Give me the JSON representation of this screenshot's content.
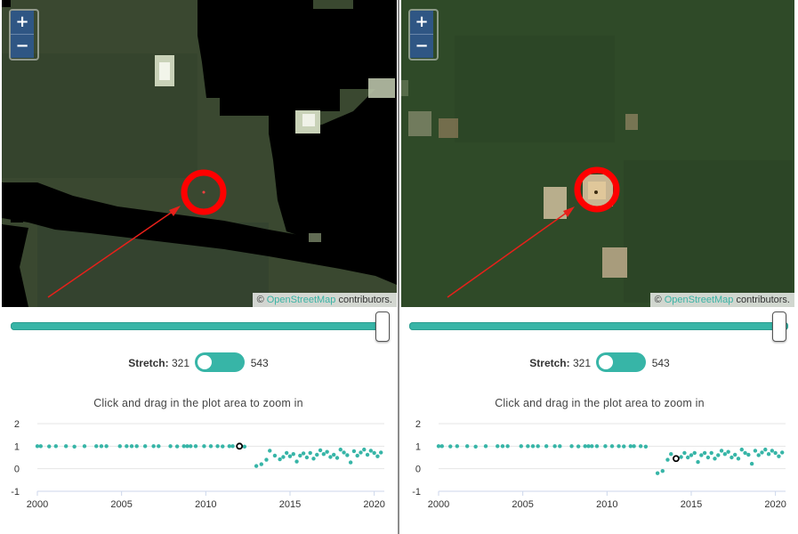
{
  "zoom": {
    "in": "+",
    "out": "−"
  },
  "attribution": {
    "copy": "©",
    "link": "OpenStreetMap",
    "suffix": " contributors."
  },
  "stretch": {
    "label": "Stretch:",
    "min": "321",
    "max": "543"
  },
  "plot_hint": "Click and drag in the plot area to zoom in",
  "colors": {
    "teal": "#37b5a7",
    "marker_red": "#ff0000",
    "zoom_button": "#2f5684",
    "link": "#3bb3a5"
  },
  "chart_data": [
    {
      "type": "scatter",
      "title": "",
      "xlabel": "",
      "ylabel": "",
      "xlim": [
        2000,
        2020.6
      ],
      "ylim": [
        -1,
        2
      ],
      "xticks": [
        2000,
        2005,
        2010,
        2015,
        2020
      ],
      "yticks": [
        -1,
        0,
        1,
        2
      ],
      "grid": true,
      "highlight": {
        "x": 2012.0,
        "y": 1.0
      },
      "series": [
        {
          "points": [
            [
              2000.0,
              1.0
            ],
            [
              2000.2,
              1.0
            ],
            [
              2000.7,
              0.99
            ],
            [
              2001.1,
              1.0
            ],
            [
              2001.7,
              1.0
            ],
            [
              2002.2,
              0.98
            ],
            [
              2002.8,
              1.0
            ],
            [
              2003.5,
              1.0
            ],
            [
              2003.8,
              1.0
            ],
            [
              2004.1,
              1.0
            ],
            [
              2004.9,
              1.0
            ],
            [
              2005.3,
              1.0
            ],
            [
              2005.6,
              1.0
            ],
            [
              2005.9,
              1.0
            ],
            [
              2006.4,
              1.0
            ],
            [
              2006.9,
              1.0
            ],
            [
              2007.2,
              1.0
            ],
            [
              2007.9,
              1.0
            ],
            [
              2008.3,
              0.99
            ],
            [
              2008.7,
              1.0
            ],
            [
              2008.9,
              1.0
            ],
            [
              2009.1,
              1.0
            ],
            [
              2009.4,
              1.0
            ],
            [
              2009.9,
              1.0
            ],
            [
              2010.3,
              1.0
            ],
            [
              2010.7,
              1.0
            ],
            [
              2011.0,
              0.99
            ],
            [
              2011.4,
              1.0
            ],
            [
              2011.6,
              1.0
            ],
            [
              2012.3,
              0.98
            ],
            [
              2013.0,
              0.12
            ],
            [
              2013.3,
              0.2
            ],
            [
              2013.6,
              0.4
            ],
            [
              2013.8,
              0.8
            ],
            [
              2014.1,
              0.58
            ],
            [
              2014.4,
              0.42
            ],
            [
              2014.6,
              0.52
            ],
            [
              2014.8,
              0.7
            ],
            [
              2015.0,
              0.55
            ],
            [
              2015.2,
              0.65
            ],
            [
              2015.4,
              0.32
            ],
            [
              2015.6,
              0.58
            ],
            [
              2015.8,
              0.68
            ],
            [
              2016.0,
              0.5
            ],
            [
              2016.2,
              0.7
            ],
            [
              2016.4,
              0.45
            ],
            [
              2016.6,
              0.62
            ],
            [
              2016.8,
              0.82
            ],
            [
              2017.0,
              0.65
            ],
            [
              2017.2,
              0.75
            ],
            [
              2017.4,
              0.52
            ],
            [
              2017.6,
              0.62
            ],
            [
              2017.8,
              0.48
            ],
            [
              2018.0,
              0.85
            ],
            [
              2018.2,
              0.72
            ],
            [
              2018.4,
              0.6
            ],
            [
              2018.6,
              0.28
            ],
            [
              2018.8,
              0.78
            ],
            [
              2019.0,
              0.58
            ],
            [
              2019.2,
              0.72
            ],
            [
              2019.4,
              0.85
            ],
            [
              2019.6,
              0.62
            ],
            [
              2019.8,
              0.8
            ],
            [
              2020.0,
              0.7
            ],
            [
              2020.2,
              0.55
            ],
            [
              2020.4,
              0.72
            ]
          ]
        }
      ]
    },
    {
      "type": "scatter",
      "title": "",
      "xlabel": "",
      "ylabel": "",
      "xlim": [
        2000,
        2020.6
      ],
      "ylim": [
        -1,
        2
      ],
      "xticks": [
        2000,
        2005,
        2010,
        2015,
        2020
      ],
      "yticks": [
        -1,
        0,
        1,
        2
      ],
      "grid": true,
      "highlight": {
        "x": 2014.1,
        "y": 0.45
      },
      "series": [
        {
          "points": [
            [
              2000.0,
              1.0
            ],
            [
              2000.2,
              1.0
            ],
            [
              2000.7,
              0.99
            ],
            [
              2001.1,
              1.0
            ],
            [
              2001.7,
              1.0
            ],
            [
              2002.2,
              0.98
            ],
            [
              2002.8,
              1.0
            ],
            [
              2003.5,
              1.0
            ],
            [
              2003.8,
              1.0
            ],
            [
              2004.1,
              1.0
            ],
            [
              2004.9,
              1.0
            ],
            [
              2005.3,
              1.0
            ],
            [
              2005.6,
              1.0
            ],
            [
              2005.9,
              1.0
            ],
            [
              2006.4,
              1.0
            ],
            [
              2006.9,
              1.0
            ],
            [
              2007.2,
              1.0
            ],
            [
              2007.9,
              1.0
            ],
            [
              2008.3,
              0.99
            ],
            [
              2008.7,
              1.0
            ],
            [
              2008.9,
              1.0
            ],
            [
              2009.1,
              1.0
            ],
            [
              2009.4,
              1.0
            ],
            [
              2009.9,
              1.0
            ],
            [
              2010.3,
              1.0
            ],
            [
              2010.7,
              1.0
            ],
            [
              2011.0,
              0.99
            ],
            [
              2011.4,
              1.0
            ],
            [
              2011.6,
              1.0
            ],
            [
              2012.0,
              1.0
            ],
            [
              2012.3,
              0.98
            ],
            [
              2013.0,
              -0.2
            ],
            [
              2013.3,
              -0.1
            ],
            [
              2013.6,
              0.4
            ],
            [
              2013.8,
              0.65
            ],
            [
              2014.4,
              0.52
            ],
            [
              2014.6,
              0.7
            ],
            [
              2014.8,
              0.5
            ],
            [
              2015.0,
              0.6
            ],
            [
              2015.2,
              0.7
            ],
            [
              2015.4,
              0.3
            ],
            [
              2015.6,
              0.6
            ],
            [
              2015.8,
              0.7
            ],
            [
              2016.0,
              0.5
            ],
            [
              2016.2,
              0.7
            ],
            [
              2016.4,
              0.45
            ],
            [
              2016.6,
              0.6
            ],
            [
              2016.8,
              0.8
            ],
            [
              2017.0,
              0.65
            ],
            [
              2017.2,
              0.75
            ],
            [
              2017.4,
              0.5
            ],
            [
              2017.6,
              0.62
            ],
            [
              2017.8,
              0.45
            ],
            [
              2018.0,
              0.85
            ],
            [
              2018.2,
              0.7
            ],
            [
              2018.4,
              0.62
            ],
            [
              2018.6,
              0.22
            ],
            [
              2018.8,
              0.8
            ],
            [
              2019.0,
              0.6
            ],
            [
              2019.2,
              0.72
            ],
            [
              2019.4,
              0.85
            ],
            [
              2019.6,
              0.65
            ],
            [
              2019.8,
              0.8
            ],
            [
              2020.0,
              0.7
            ],
            [
              2020.2,
              0.55
            ],
            [
              2020.4,
              0.72
            ]
          ]
        }
      ]
    }
  ]
}
